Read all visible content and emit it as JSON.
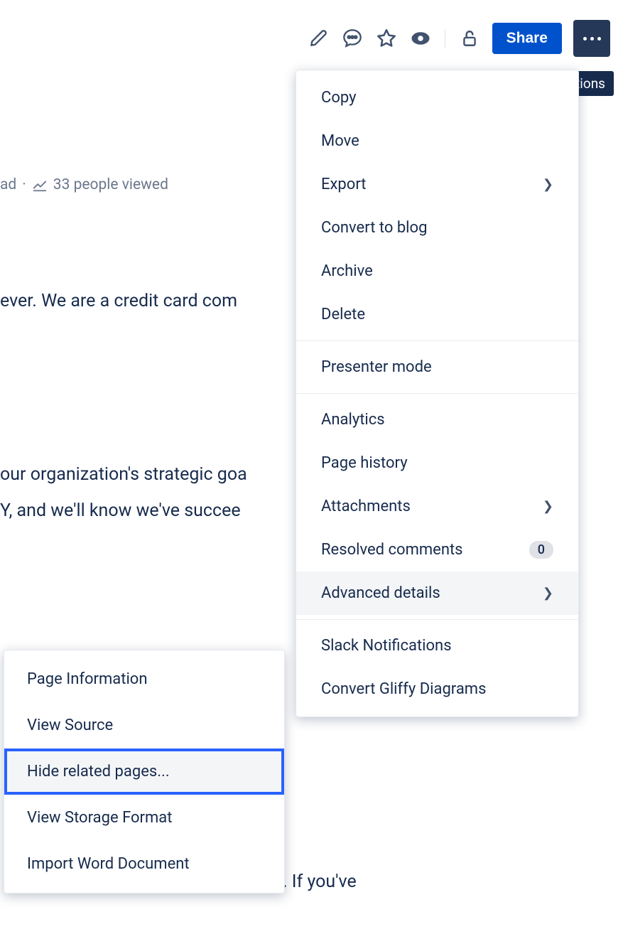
{
  "toolbar": {
    "share_label": "Share"
  },
  "tooltip": {
    "more_actions": "More actions"
  },
  "meta": {
    "partial_word": "ad",
    "dot": "·",
    "views": "33 people viewed"
  },
  "body": {
    "line1": "ever. We are a credit card com",
    "line2": "our organization's strategic goa",
    "line3": "Y, and we'll know we've succee",
    "line4": ". If you've"
  },
  "main_menu": {
    "copy": "Copy",
    "move": "Move",
    "export": "Export",
    "convert_blog": "Convert to blog",
    "archive": "Archive",
    "delete": "Delete",
    "presenter": "Presenter mode",
    "analytics": "Analytics",
    "page_history": "Page history",
    "attachments": "Attachments",
    "resolved_comments": "Resolved comments",
    "resolved_count": "0",
    "advanced_details": "Advanced details",
    "slack": "Slack Notifications",
    "convert_gliffy": "Convert Gliffy Diagrams"
  },
  "sub_menu": {
    "page_info": "Page Information",
    "view_source": "View Source",
    "hide_related": "Hide related pages...",
    "view_storage": "View Storage Format",
    "import_word": "Import Word Document"
  }
}
